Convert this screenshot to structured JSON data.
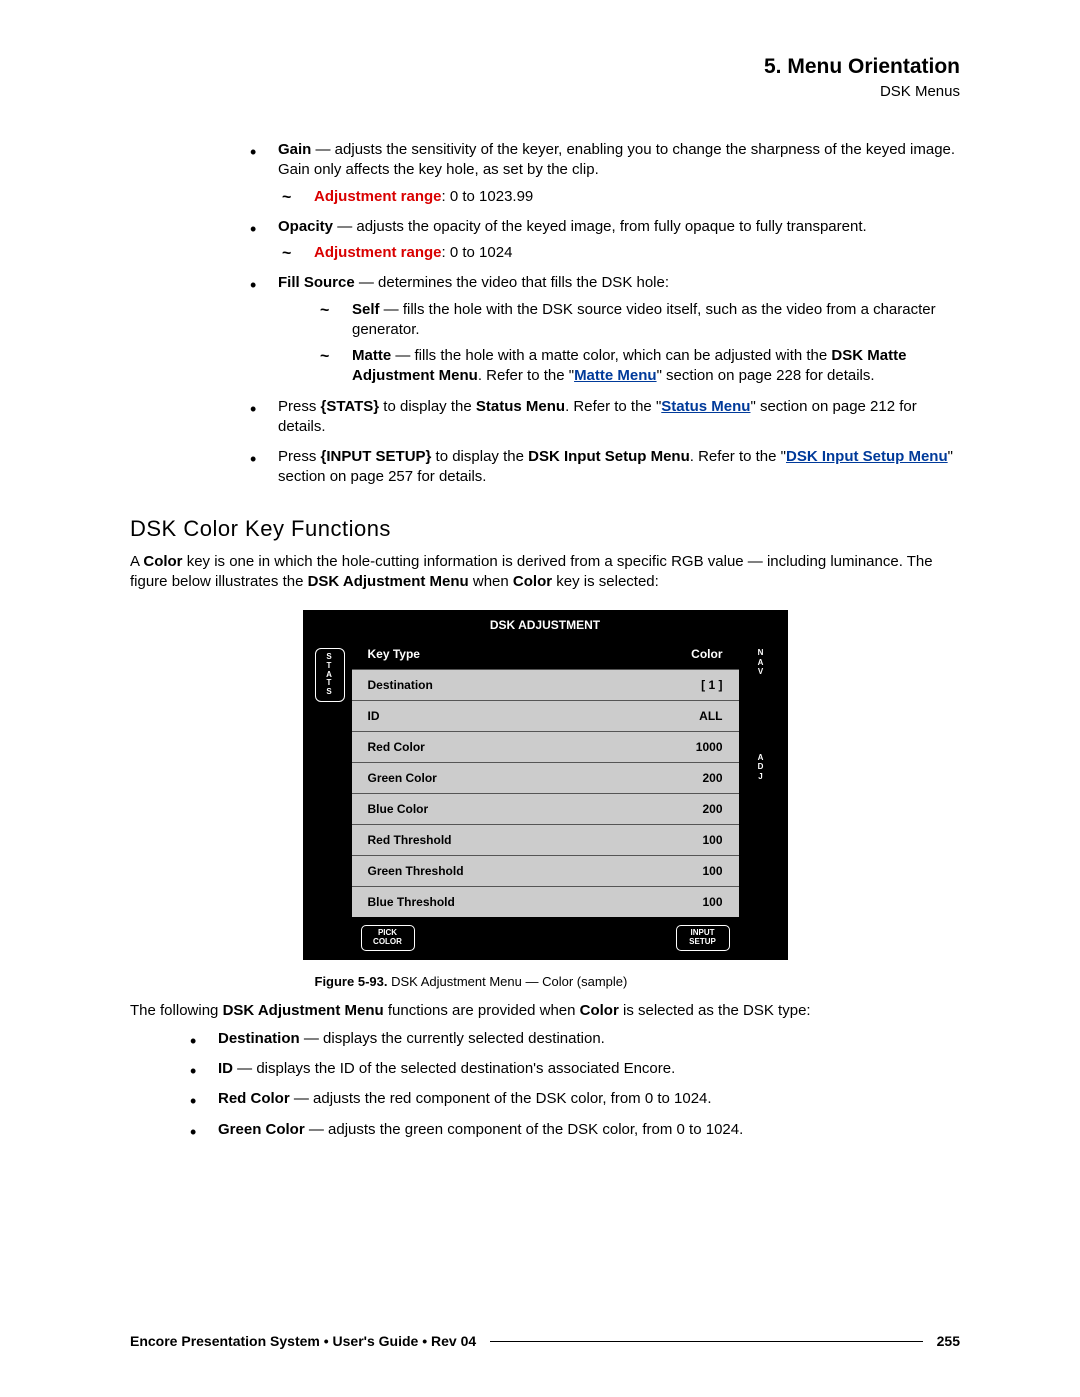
{
  "header": {
    "title": "5.  Menu Orientation",
    "subtitle": "DSK Menus"
  },
  "bullets": {
    "gain": {
      "term": "Gain",
      "desc": " — adjusts the sensitivity of the keyer, enabling you to change the sharpness of the keyed image.  Gain only affects the key hole, as set by the clip.",
      "adj_label": "Adjustment range",
      "adj_value": ":  0 to 1023.99"
    },
    "opacity": {
      "term": "Opacity",
      "desc": " — adjusts the opacity of the keyed image, from fully opaque to fully transparent.",
      "adj_label": "Adjustment range",
      "adj_value": ":  0 to 1024"
    },
    "fill": {
      "term": "Fill Source",
      "desc": " — determines the video that fills the DSK hole:",
      "self_term": "Self",
      "self_desc": " — fills the hole with the DSK source video itself, such as the video from a character generator.",
      "matte_term": "Matte",
      "matte_desc1": " — fills the hole with a matte color, which can be adjusted with the ",
      "matte_bold": "DSK Matte Adjustment Menu",
      "matte_desc2": ".  Refer to the \"",
      "matte_link": "Matte Menu",
      "matte_desc3": "\" section on page 228 for details."
    },
    "stats": {
      "p1": "Press ",
      "b1": "{STATS}",
      "p2": " to display the ",
      "b2": "Status Menu",
      "p3": ".  Refer to the \"",
      "link": "Status Menu",
      "p4": "\" section on page 212 for details."
    },
    "input": {
      "p1": "Press ",
      "b1": "{INPUT SETUP}",
      "p2": " to display the ",
      "b2": "DSK Input Setup Menu",
      "p3": ".  Refer to the \"",
      "link": "DSK Input Setup Menu",
      "p4": "\" section on page 257 for details."
    }
  },
  "section": {
    "title": "DSK Color Key Functions",
    "intro1": "A ",
    "intro_b1": "Color",
    "intro2": " key is one in which the hole-cutting information is derived from a specific RGB value — including luminance.  The figure below illustrates the ",
    "intro_b2": "DSK Adjustment Menu",
    "intro3": " when ",
    "intro_b3": "Color",
    "intro4": " key is selected:"
  },
  "menu": {
    "title": "DSK ADJUSTMENT",
    "left_btn": "S\nT\nA\nT\nS",
    "right_nav": "N\nA\nV",
    "right_adj": "A\nD\nJ",
    "rows": [
      {
        "label": "Key Type",
        "value": "Color",
        "hl": true
      },
      {
        "label": "Destination",
        "value": "[ 1 ]"
      },
      {
        "label": "ID",
        "value": "ALL"
      },
      {
        "label": "Red Color",
        "value": "1000"
      },
      {
        "label": "Green Color",
        "value": "200"
      },
      {
        "label": "Blue Color",
        "value": "200"
      },
      {
        "label": "Red Threshold",
        "value": "100"
      },
      {
        "label": "Green Threshold",
        "value": "100"
      },
      {
        "label": "Blue Threshold",
        "value": "100"
      }
    ],
    "btn_pick": "PICK\nCOLOR",
    "btn_input": "INPUT\nSETUP"
  },
  "caption": {
    "bold": "Figure 5-93.",
    "text": "   DSK Adjustment Menu — Color (sample)"
  },
  "post": {
    "p1": "The following ",
    "b1": "DSK Adjustment Menu",
    "p2": " functions are provided when ",
    "b2": "Color",
    "p3": " is selected as the DSK type:"
  },
  "post_bullets": {
    "dest": {
      "t": "Destination",
      "d": " — displays the currently selected destination."
    },
    "id": {
      "t": "ID",
      "d": " — displays the ID of the selected destination's associated Encore."
    },
    "red": {
      "t": "Red Color",
      "d": " — adjusts the red component of the DSK color, from 0 to 1024."
    },
    "green": {
      "t": "Green Color",
      "d": " — adjusts the green component of the DSK color, from 0 to 1024."
    }
  },
  "footer": {
    "text": "Encore Presentation System  •  User's Guide  •  Rev 04",
    "page": "255"
  }
}
